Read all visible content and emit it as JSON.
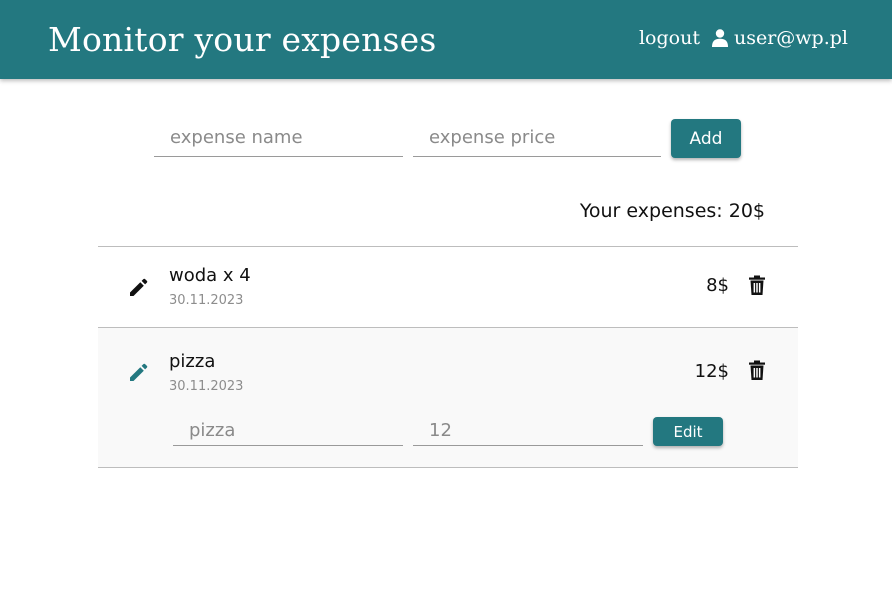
{
  "header": {
    "title": "Monitor your expenses",
    "logout_label": "logout",
    "user_email": "user@wp.pl",
    "background_color": "#237880"
  },
  "add_form": {
    "name_placeholder": "expense name",
    "price_placeholder": "expense price",
    "add_label": "Add"
  },
  "total_label": "Your expenses: 20$",
  "expenses": [
    {
      "name": "woda x 4",
      "date": "30.11.2023",
      "price": "8$",
      "edit_icon": "pencil-icon",
      "delete_icon": "trash-icon",
      "editing": false
    },
    {
      "name": "pizza",
      "date": "30.11.2023",
      "price": "12$",
      "edit_icon": "pencil-icon",
      "delete_icon": "trash-icon",
      "editing": true
    }
  ],
  "edit_form": {
    "name_value": "pizza",
    "price_value": "12",
    "edit_label": "Edit"
  },
  "colors": {
    "accent": "#237880",
    "active_pencil": "#237880",
    "editing_row_background": "#f9f9f9"
  }
}
